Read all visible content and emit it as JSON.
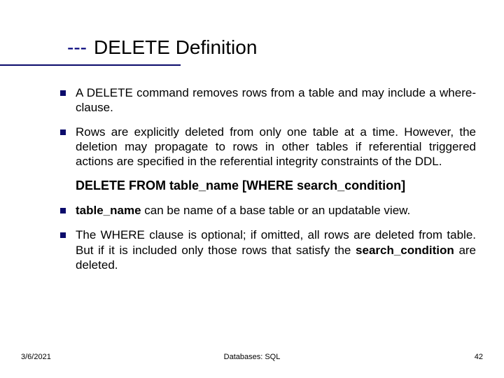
{
  "title": {
    "dashes": "---",
    "text": "DELETE Definition"
  },
  "bullets": [
    {
      "html": "A DELETE command removes rows from a table and may include a where-clause."
    },
    {
      "html": "Rows are explicitly deleted from only one table at a time. However, the deletion may propagate to rows in other tables if referential triggered actions are specified in the referential integrity constraints of the DDL."
    }
  ],
  "syntax": "DELETE FROM table_name  [WHERE search_condition]",
  "bullets2": [
    {
      "html": "<span class=\"bold\">table_name</span> can be name of a base table or an updatable view."
    },
    {
      "html": "The WHERE clause is optional; if omitted, all rows are deleted from table. But if it is included  only those rows that satisfy the <span class=\"bold\">search_condition</span> are deleted."
    }
  ],
  "footer": {
    "date": "3/6/2021",
    "center": "Databases: SQL",
    "page": "42"
  }
}
